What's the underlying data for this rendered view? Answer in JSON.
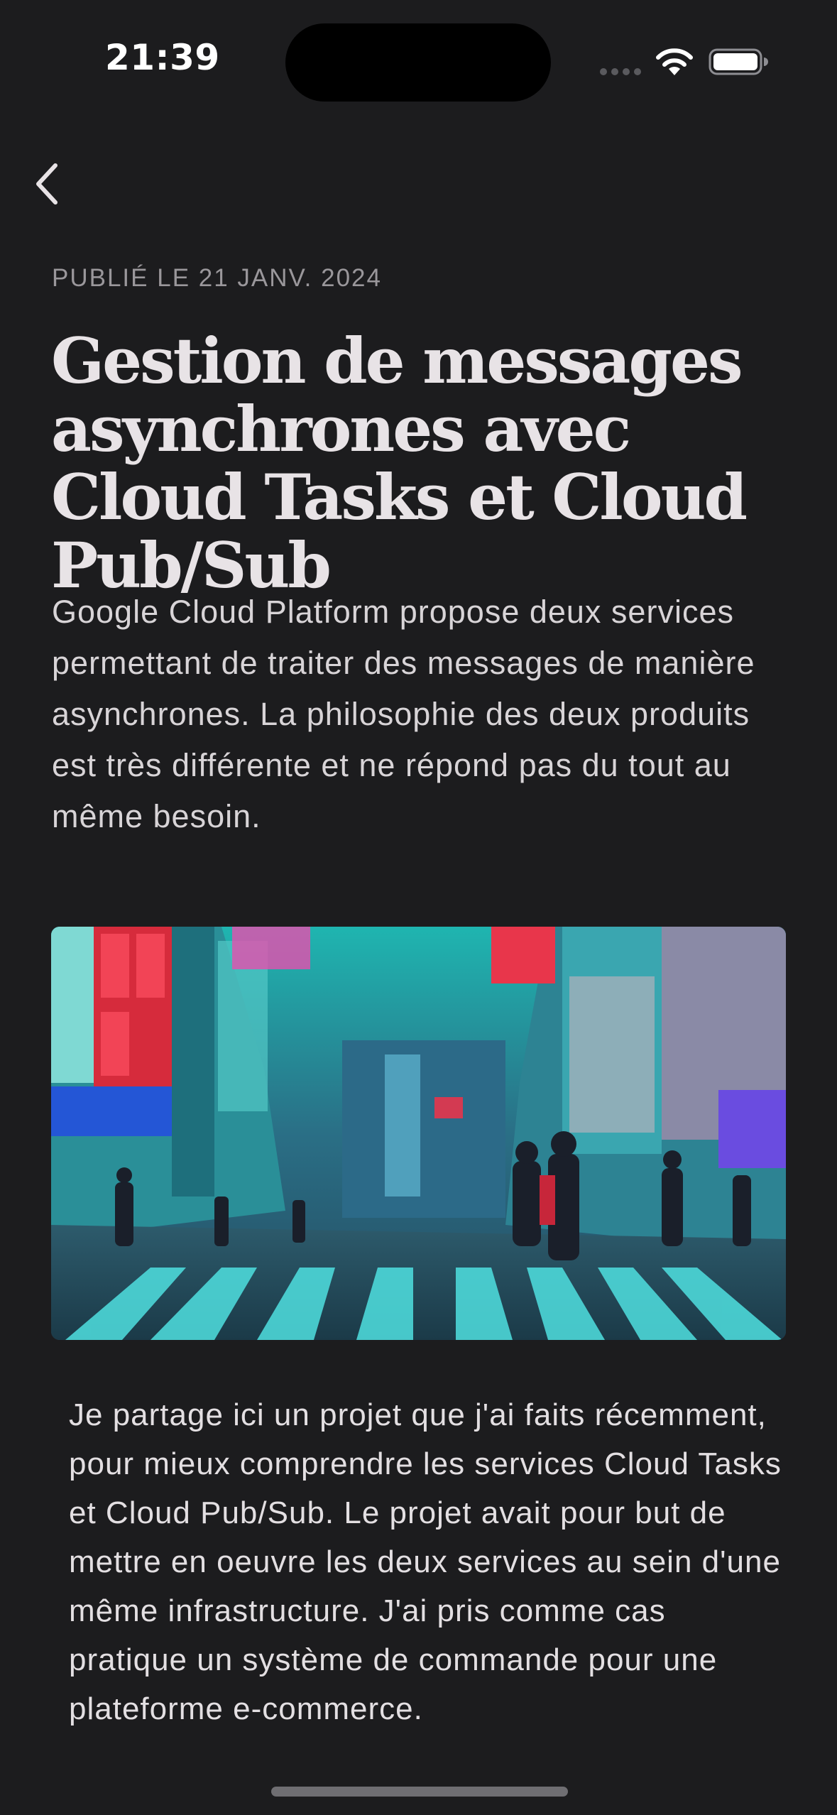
{
  "status_bar": {
    "time": "21:39"
  },
  "nav": {
    "back_icon": "chevron-left-icon"
  },
  "article": {
    "date": "PUBLIÉ LE 21 JANV. 2024",
    "title": "Gestion de messages asynchrones avec Cloud Tasks et Cloud Pub/Sub",
    "lead": "Google Cloud Platform propose deux services permettant de traiter des messages de manière asynchrones. La philosophie des deux produits est très différente et ne répond pas du tout au même besoin.",
    "body": "Je partage ici un projet que j'ai faits récemment, pour mieux comprendre les services Cloud Tasks et Cloud Pub/Sub. Le projet avait pour but de mettre en oeuvre les deux services au sein d'une même infrastructure. J'ai pris comme cas pratique un système de commande pour une plateforme e-commerce."
  },
  "colors": {
    "background": "#1c1c1e",
    "text": "#e5e1e3",
    "muted": "#9a979b"
  }
}
